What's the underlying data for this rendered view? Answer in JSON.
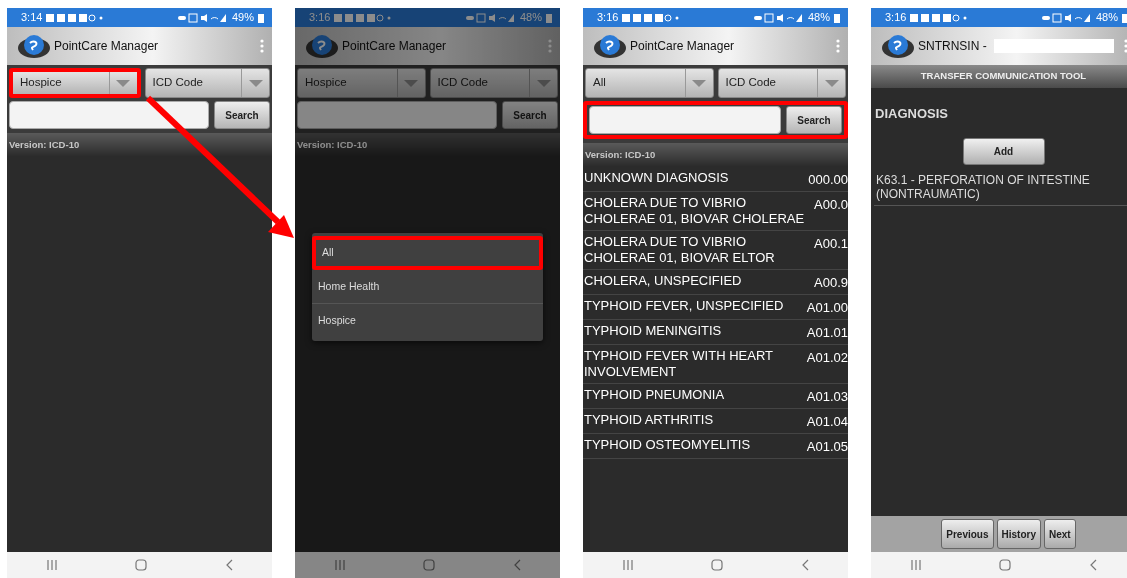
{
  "screens": [
    {
      "kind": "search",
      "dimmed": false,
      "status": {
        "time": "3:14",
        "battery": "49%"
      },
      "app_title": "PointCare Manager",
      "filters": [
        {
          "value": "Hospice",
          "highlighted": true
        },
        {
          "value": "ICD Code",
          "highlighted": false
        }
      ],
      "search_button": "Search",
      "search_highlighted": false,
      "version": "Version: ICD-10"
    },
    {
      "kind": "search",
      "dimmed": true,
      "status": {
        "time": "3:16",
        "battery": "48%"
      },
      "app_title": "PointCare Manager",
      "filters": [
        {
          "value": "Hospice",
          "highlighted": false
        },
        {
          "value": "ICD Code",
          "highlighted": false
        }
      ],
      "search_button": "Search",
      "search_highlighted": false,
      "version": "Version: ICD-10",
      "dialog_options": [
        {
          "label": "All",
          "highlighted": true
        },
        {
          "label": "Home Health",
          "highlighted": false
        },
        {
          "label": "Hospice",
          "highlighted": false
        }
      ]
    },
    {
      "kind": "search",
      "dimmed": false,
      "status": {
        "time": "3:16",
        "battery": "48%"
      },
      "app_title": "PointCare Manager",
      "filters": [
        {
          "value": "All",
          "highlighted": false
        },
        {
          "value": "ICD Code",
          "highlighted": false
        }
      ],
      "search_button": "Search",
      "search_highlighted": true,
      "version": "Version: ICD-10",
      "results": [
        {
          "name": "UNKNOWN DIAGNOSIS",
          "code": "000.00"
        },
        {
          "name": "CHOLERA DUE TO VIBRIO CHOLERAE 01, BIOVAR CHOLERAE",
          "code": "A00.0"
        },
        {
          "name": "CHOLERA DUE TO VIBRIO CHOLERAE 01, BIOVAR ELTOR",
          "code": "A00.1"
        },
        {
          "name": "CHOLERA, UNSPECIFIED",
          "code": "A00.9"
        },
        {
          "name": "TYPHOID FEVER, UNSPECIFIED",
          "code": "A01.00"
        },
        {
          "name": "TYPHOID MENINGITIS",
          "code": "A01.01"
        },
        {
          "name": "TYPHOID FEVER WITH HEART INVOLVEMENT",
          "code": "A01.02"
        },
        {
          "name": "TYPHOID PNEUMONIA",
          "code": "A01.03"
        },
        {
          "name": "TYPHOID ARTHRITIS",
          "code": "A01.04"
        },
        {
          "name": "TYPHOID OSTEOMYELITIS",
          "code": "A01.05"
        }
      ]
    },
    {
      "kind": "transfer",
      "dimmed": false,
      "status": {
        "time": "3:16",
        "battery": "48%"
      },
      "app_title": "SNTRNSIN -",
      "section_header": "TRANSFER COMMUNICATION TOOL",
      "heading": "DIAGNOSIS",
      "add_button": "Add",
      "diagnoses": [
        "K63.1 - PERFORATION OF INTESTINE (NONTRAUMATIC)"
      ],
      "footer_buttons": [
        "Previous",
        "History",
        "Next"
      ]
    }
  ]
}
